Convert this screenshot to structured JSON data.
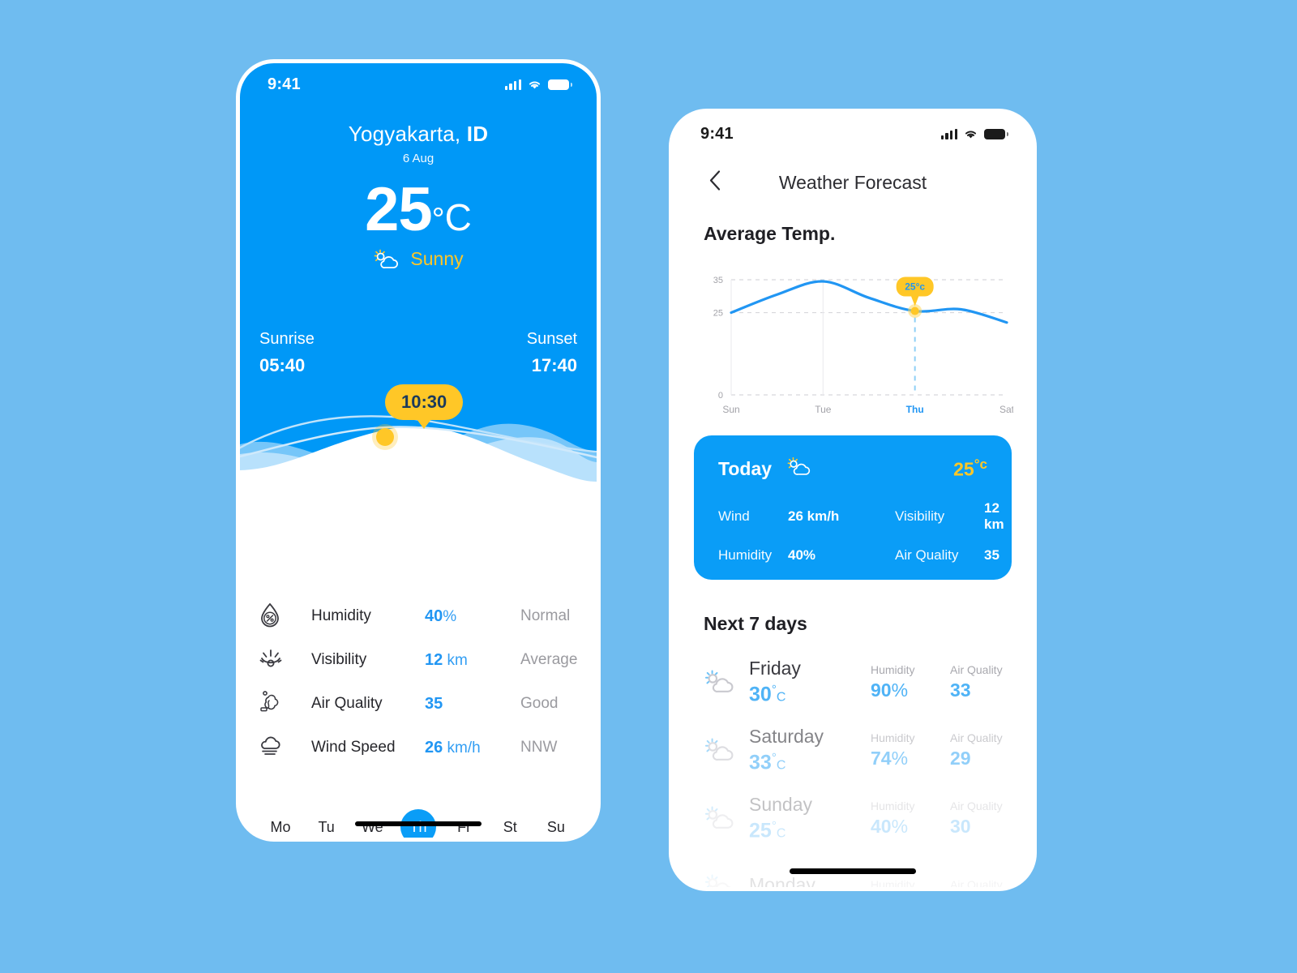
{
  "canvas": {
    "background": "#6FBCF0"
  },
  "colors": {
    "brand_blue": "#0098F7",
    "accent_blue": "#2196F3",
    "light_blue": "#4FB3F6",
    "yellow": "#FFC727",
    "muted": "#9A9A9F"
  },
  "home_screen": {
    "status_bar": {
      "time": "9:41",
      "signal_icon": "cellular-signal-icon",
      "wifi_icon": "wifi-icon",
      "battery_icon": "battery-icon"
    },
    "location": "Yogyakarta, ID",
    "location_city": "Yogyakarta,",
    "location_country": "ID",
    "date": "6 Aug",
    "temperature": "25",
    "degree_symbol": "°",
    "unit": "C",
    "condition": "Sunny",
    "condition_icon": "sun-behind-cloud-icon",
    "sun": {
      "sunrise_label": "Sunrise",
      "sunrise_time": "05:40",
      "sunset_label": "Sunset",
      "sunset_time": "17:40",
      "current_time_bubble": "10:30"
    },
    "details": [
      {
        "icon": "humidity-drop-icon",
        "label": "Humidity",
        "value": "40",
        "unit": "%",
        "status": "Normal"
      },
      {
        "icon": "visibility-eye-icon",
        "label": "Visibility",
        "value": "12",
        "unit": " km",
        "status": "Average"
      },
      {
        "icon": "air-quality-smoke-icon",
        "label": "Air Quality",
        "value": "35",
        "unit": "",
        "status": "Good"
      },
      {
        "icon": "wind-cloud-icon",
        "label": "Wind Speed",
        "value": "26",
        "unit": " km/h",
        "status": "NNW"
      }
    ],
    "days": [
      {
        "label": "Mo",
        "active": false
      },
      {
        "label": "Tu",
        "active": false
      },
      {
        "label": "We",
        "active": false
      },
      {
        "label": "Th",
        "active": true
      },
      {
        "label": "Fr",
        "active": false
      },
      {
        "label": "St",
        "active": false
      },
      {
        "label": "Su",
        "active": false
      }
    ]
  },
  "forecast_screen": {
    "status_bar": {
      "time": "9:41",
      "signal_icon": "cellular-signal-icon",
      "wifi_icon": "wifi-icon",
      "battery_icon": "battery-icon"
    },
    "back_icon": "chevron-left-icon",
    "title": "Weather Forecast",
    "average_temp_title": "Average Temp.",
    "next_days_title": "Next 7 days",
    "today_card": {
      "label": "Today",
      "icon": "sun-behind-cloud-icon",
      "temp": "25",
      "temp_unit": "°c",
      "metrics": [
        {
          "key": "Wind",
          "value": "26 km/h"
        },
        {
          "key": "Visibility",
          "value": "12 km"
        },
        {
          "key": "Humidity",
          "value": "40%"
        },
        {
          "key": "Air Quality",
          "value": "35"
        }
      ]
    },
    "next_days": [
      {
        "icon": "sun-behind-cloud-icon",
        "name": "Friday",
        "temp": "30",
        "deg": "°",
        "unit": "C",
        "humidity_label": "Humidity",
        "humidity": "90",
        "humidity_unit": "%",
        "aq_label": "Air Quality",
        "aq": "33",
        "opacity_class": "fade-1"
      },
      {
        "icon": "sun-behind-cloud-icon",
        "name": "Saturday",
        "temp": "33",
        "deg": "°",
        "unit": "C",
        "humidity_label": "Humidity",
        "humidity": "74",
        "humidity_unit": "%",
        "aq_label": "Air Quality",
        "aq": "29",
        "opacity_class": "fade-2"
      },
      {
        "icon": "sun-behind-cloud-icon",
        "name": "Sunday",
        "temp": "25",
        "deg": "°",
        "unit": "C",
        "humidity_label": "Humidity",
        "humidity": "40",
        "humidity_unit": "%",
        "aq_label": "Air Quality",
        "aq": "30",
        "opacity_class": "fade-3"
      },
      {
        "icon": "sun-behind-cloud-icon",
        "name": "Monday",
        "temp": "",
        "deg": "",
        "unit": "",
        "humidity_label": "Humidity",
        "humidity": "",
        "humidity_unit": "",
        "aq_label": "Air Quality",
        "aq": "",
        "opacity_class": "fade-4"
      }
    ]
  },
  "chart_data": {
    "type": "line",
    "title": "Average Temp.",
    "xlabel": "",
    "ylabel": "",
    "ylim": [
      0,
      35
    ],
    "yticks": [
      0,
      25,
      35
    ],
    "ytick_labels": [
      "0",
      "25",
      "35"
    ],
    "xticks": [
      "Sun",
      "Tue",
      "Thu",
      "Sat"
    ],
    "xtick_positions": [
      0,
      2,
      4,
      6
    ],
    "x": [
      "Sun",
      "Mon",
      "Tue",
      "Wed",
      "Thu",
      "Fri",
      "Sat"
    ],
    "values": [
      25,
      30.5,
      34.5,
      29.5,
      25.5,
      26,
      22
    ],
    "grid": true,
    "grid_style": "dashed-horizontal",
    "legend": null,
    "highlight": {
      "x": "Thu",
      "y": 25,
      "label": "25°c",
      "marker": "yellow-dot",
      "guideline": "dashed-vertical"
    },
    "line_color": "#2196F3",
    "highlight_color": "#FFC727",
    "active_xtick": "Thu"
  }
}
